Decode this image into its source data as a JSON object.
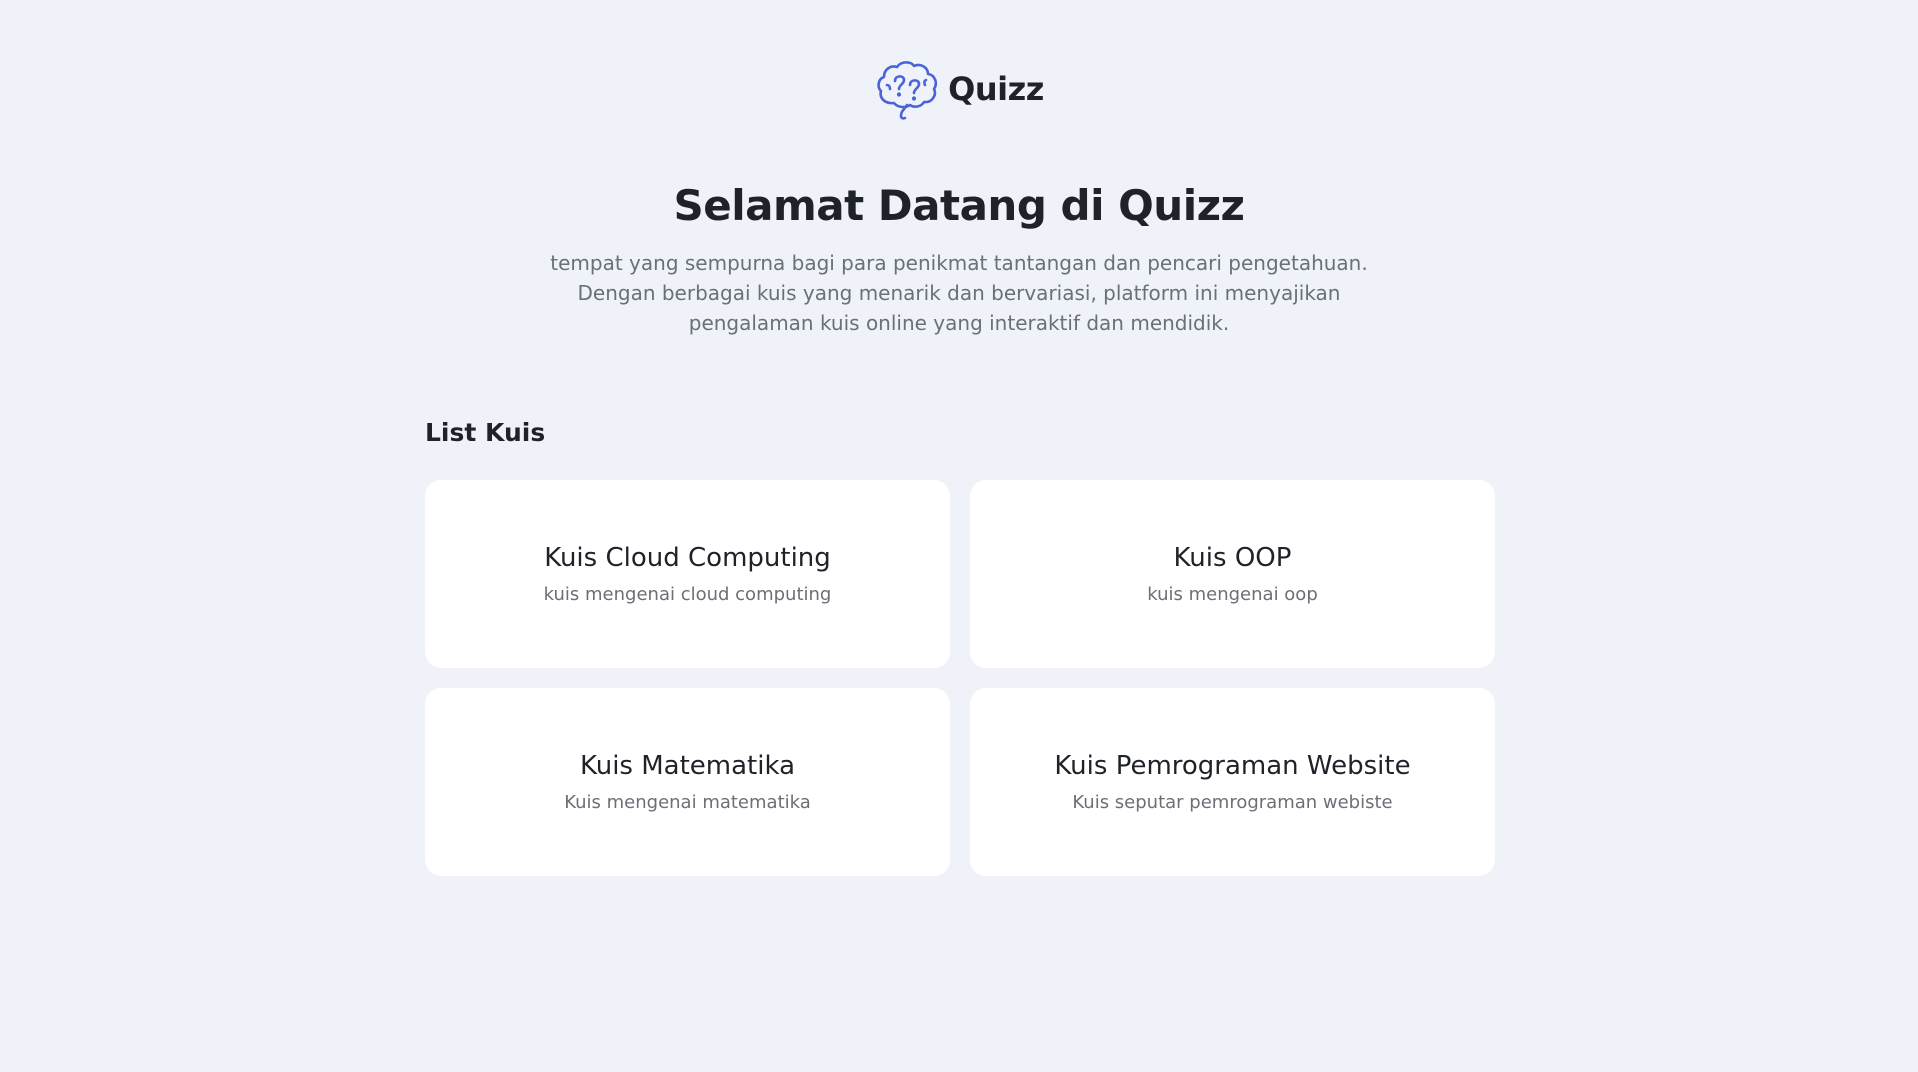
{
  "header": {
    "brand_name": "Quizz",
    "logo_icon": "brain-question-icon",
    "accent_color": "#4a63d8"
  },
  "hero": {
    "title": "Selamat Datang di Quizz",
    "description_lines": [
      "tempat yang sempurna bagi para penikmat tantangan dan pencari pengetahuan.",
      "Dengan berbagai kuis yang menarik dan bervariasi, platform ini menyajikan",
      "pengalaman kuis online yang interaktif dan mendidik."
    ]
  },
  "quiz_list": {
    "heading": "List Kuis",
    "items": [
      {
        "title": "Kuis Cloud Computing",
        "description": "kuis mengenai cloud computing"
      },
      {
        "title": "Kuis OOP",
        "description": "kuis mengenai oop"
      },
      {
        "title": "Kuis Matematika",
        "description": "Kuis mengenai matematika"
      },
      {
        "title": "Kuis Pemrograman Website",
        "description": "Kuis seputar pemrograman webiste"
      }
    ]
  }
}
